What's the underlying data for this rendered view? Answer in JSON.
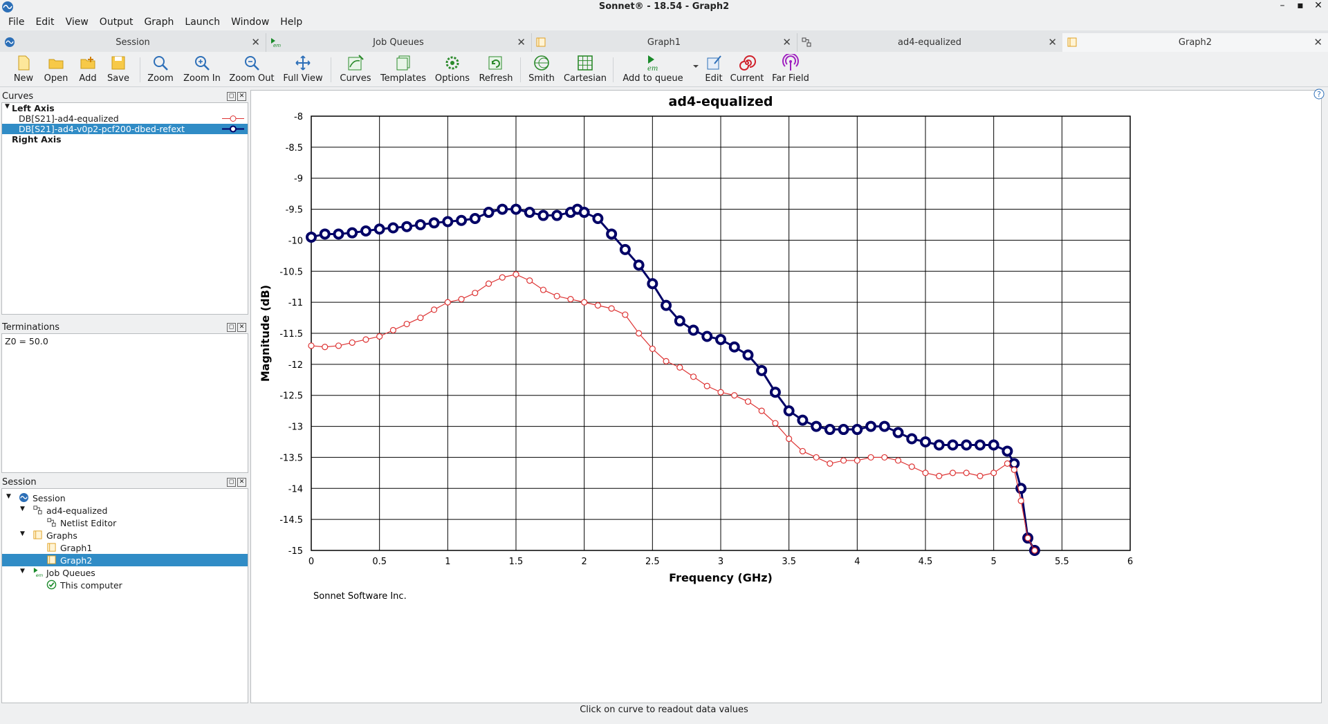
{
  "window": {
    "title": "Sonnet® - 18.54 - Graph2",
    "minimize_label": "–",
    "maximize_label": "▪",
    "close_label": "✕"
  },
  "menu": [
    "File",
    "Edit",
    "View",
    "Output",
    "Graph",
    "Launch",
    "Window",
    "Help"
  ],
  "tabs": [
    {
      "label": "Session",
      "icon": "sonnet-logo-icon"
    },
    {
      "label": "Job Queues",
      "icon": "em-run-icon"
    },
    {
      "label": "Graph1",
      "icon": "graph-doc-icon"
    },
    {
      "label": "ad4-equalized",
      "icon": "netlist-icon"
    },
    {
      "label": "Graph2",
      "icon": "graph-doc-icon"
    }
  ],
  "tab_close": "✕",
  "toolbar": [
    {
      "label": "New",
      "icon": "new-file-icon"
    },
    {
      "label": "Open",
      "icon": "open-folder-icon"
    },
    {
      "label": "Add",
      "icon": "add-folder-icon"
    },
    {
      "label": "Save",
      "icon": "save-icon"
    },
    {
      "label": "Zoom",
      "icon": "zoom-icon"
    },
    {
      "label": "Zoom In",
      "icon": "zoom-in-icon"
    },
    {
      "label": "Zoom Out",
      "icon": "zoom-out-icon"
    },
    {
      "label": "Full View",
      "icon": "full-view-icon"
    },
    {
      "label": "Curves",
      "icon": "curves-icon"
    },
    {
      "label": "Templates",
      "icon": "templates-icon"
    },
    {
      "label": "Options",
      "icon": "options-icon"
    },
    {
      "label": "Refresh",
      "icon": "refresh-icon"
    },
    {
      "label": "Smith",
      "icon": "smith-chart-icon"
    },
    {
      "label": "Cartesian",
      "icon": "cartesian-grid-icon"
    },
    {
      "label": "Add to queue",
      "icon": "em-queue-icon"
    },
    {
      "label": "Edit",
      "icon": "edit-icon"
    },
    {
      "label": "Current",
      "icon": "current-icon"
    },
    {
      "label": "Far Field",
      "icon": "far-field-icon"
    }
  ],
  "curves_panel": {
    "title": "Curves",
    "left_axis": "Left Axis",
    "items": [
      "DB[S21]-ad4-equalized",
      "DB[S21]-ad4-v0p2-pcf200-dbed-refext"
    ],
    "right_axis": "Right Axis"
  },
  "terminations_panel": {
    "title": "Terminations",
    "value": "Z0 = 50.0"
  },
  "session_panel": {
    "title": "Session",
    "tree": [
      {
        "label": "Session"
      },
      {
        "label": "ad4-equalized"
      },
      {
        "label": "Netlist Editor"
      },
      {
        "label": "Graphs"
      },
      {
        "label": "Graph1"
      },
      {
        "label": "Graph2"
      },
      {
        "label": "Job Queues"
      },
      {
        "label": "This computer"
      }
    ]
  },
  "panel_buttons": {
    "float": "◻",
    "close": "✕"
  },
  "colors": {
    "series1": "#000066",
    "series2": "#dd3333",
    "selection": "#308cc6"
  },
  "chart_data": {
    "type": "line",
    "title": "ad4-equalized",
    "xlabel": "Frequency (GHz)",
    "ylabel": "Magnitude (dB)",
    "xlim": [
      0,
      6
    ],
    "ylim": [
      -15,
      -8
    ],
    "xticks": [
      "0",
      "0.5",
      "1",
      "1.5",
      "2",
      "2.5",
      "3",
      "3.5",
      "4",
      "4.5",
      "5",
      "5.5",
      "6"
    ],
    "yticks": [
      "-8",
      "-8.5",
      "-9",
      "-9.5",
      "-10",
      "-10.5",
      "-11",
      "-11.5",
      "-12",
      "-12.5",
      "-13",
      "-13.5",
      "-14",
      "-14.5",
      "-15"
    ],
    "grid": true,
    "watermark": "Sonnet Software Inc.",
    "series": [
      {
        "name": "DB[S21]-ad4-v0p2-pcf200-dbed-refext",
        "marker": "filled-circle",
        "x": [
          0,
          0.1,
          0.2,
          0.3,
          0.4,
          0.5,
          0.6,
          0.7,
          0.8,
          0.9,
          1.0,
          1.1,
          1.2,
          1.3,
          1.4,
          1.5,
          1.6,
          1.7,
          1.8,
          1.9,
          1.95,
          2.0,
          2.1,
          2.2,
          2.3,
          2.4,
          2.5,
          2.6,
          2.7,
          2.8,
          2.9,
          3.0,
          3.1,
          3.2,
          3.3,
          3.4,
          3.5,
          3.6,
          3.7,
          3.8,
          3.9,
          4.0,
          4.1,
          4.2,
          4.3,
          4.4,
          4.5,
          4.6,
          4.7,
          4.8,
          4.9,
          5.0,
          5.1,
          5.15,
          5.2,
          5.25,
          5.3
        ],
        "y": [
          -9.95,
          -9.9,
          -9.9,
          -9.88,
          -9.85,
          -9.82,
          -9.8,
          -9.78,
          -9.75,
          -9.72,
          -9.7,
          -9.68,
          -9.65,
          -9.55,
          -9.5,
          -9.5,
          -9.55,
          -9.6,
          -9.6,
          -9.55,
          -9.5,
          -9.55,
          -9.65,
          -9.9,
          -10.15,
          -10.4,
          -10.7,
          -11.05,
          -11.3,
          -11.45,
          -11.55,
          -11.6,
          -11.72,
          -11.85,
          -12.1,
          -12.45,
          -12.75,
          -12.9,
          -13.0,
          -13.05,
          -13.05,
          -13.05,
          -13.0,
          -13.0,
          -13.1,
          -13.2,
          -13.25,
          -13.3,
          -13.3,
          -13.3,
          -13.3,
          -13.3,
          -13.4,
          -13.6,
          -14.0,
          -14.8,
          -15.0
        ]
      },
      {
        "name": "DB[S21]-ad4-equalized",
        "marker": "open-circle",
        "x": [
          0,
          0.1,
          0.2,
          0.3,
          0.4,
          0.5,
          0.6,
          0.7,
          0.8,
          0.9,
          1.0,
          1.1,
          1.2,
          1.3,
          1.4,
          1.5,
          1.6,
          1.7,
          1.8,
          1.9,
          2.0,
          2.1,
          2.2,
          2.3,
          2.4,
          2.5,
          2.6,
          2.7,
          2.8,
          2.9,
          3.0,
          3.1,
          3.2,
          3.3,
          3.4,
          3.5,
          3.6,
          3.7,
          3.8,
          3.9,
          4.0,
          4.1,
          4.2,
          4.3,
          4.4,
          4.5,
          4.6,
          4.7,
          4.8,
          4.9,
          5.0,
          5.1,
          5.15,
          5.2,
          5.25,
          5.3
        ],
        "y": [
          -11.7,
          -11.72,
          -11.7,
          -11.65,
          -11.6,
          -11.55,
          -11.45,
          -11.35,
          -11.25,
          -11.12,
          -11.0,
          -10.95,
          -10.85,
          -10.7,
          -10.6,
          -10.55,
          -10.65,
          -10.8,
          -10.9,
          -10.95,
          -11.0,
          -11.05,
          -11.1,
          -11.2,
          -11.5,
          -11.75,
          -11.95,
          -12.05,
          -12.2,
          -12.35,
          -12.45,
          -12.5,
          -12.6,
          -12.75,
          -12.95,
          -13.2,
          -13.4,
          -13.5,
          -13.6,
          -13.55,
          -13.55,
          -13.5,
          -13.5,
          -13.55,
          -13.65,
          -13.75,
          -13.8,
          -13.75,
          -13.75,
          -13.8,
          -13.75,
          -13.6,
          -13.7,
          -14.2,
          -14.8,
          -15.0
        ]
      }
    ]
  },
  "status": "Click on curve to readout data values"
}
